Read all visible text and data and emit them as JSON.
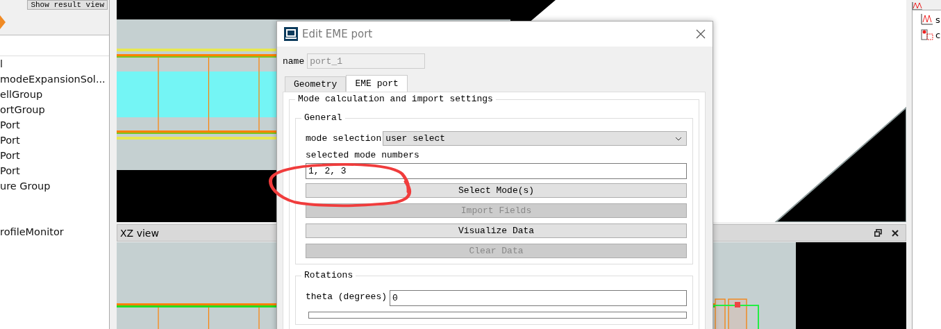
{
  "left_panel": {
    "toolbar_button": "Show result view",
    "tree_items": [
      "l",
      "modeExpansionSol...",
      "ellGroup",
      "ortGroup",
      "Port",
      "Port",
      "Port",
      "Port",
      "ure Group",
      "rofileMonitor"
    ]
  },
  "right_panel": {
    "tree_items": [
      "s",
      "c"
    ]
  },
  "xz_view": {
    "title": "XZ view"
  },
  "dialog": {
    "title": "Edit EME port",
    "name_label": "name",
    "name_value": "port_1",
    "tabs": [
      {
        "label": "Geometry",
        "selected": false
      },
      {
        "label": "EME port",
        "selected": true
      }
    ],
    "group_title": "Mode calculation and import settings",
    "subgroup_title": "General",
    "mode_selection": {
      "label": "mode selection",
      "value": "user select"
    },
    "selected_modes": {
      "label": "selected mode numbers",
      "value": "1, 2, 3"
    },
    "buttons": [
      {
        "label": "Select Mode(s)",
        "disabled": false
      },
      {
        "label": "Import Fields",
        "disabled": true
      },
      {
        "label": "Visualize Data",
        "disabled": false
      },
      {
        "label": "Clear Data",
        "disabled": true
      }
    ],
    "rotations": {
      "title": "Rotations",
      "fields": [
        {
          "label": "theta (degrees)",
          "value": "0"
        }
      ]
    }
  }
}
